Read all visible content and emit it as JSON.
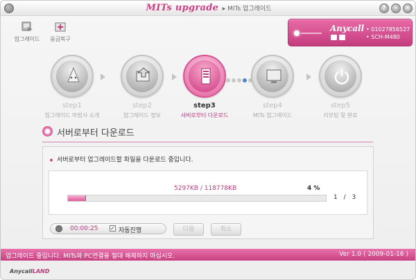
{
  "window": {
    "title_logo": "MITs upgrade",
    "title_sub": "▸ MITs 업그레이드",
    "help_label": "?",
    "minimize_label": "–",
    "close_label": "×"
  },
  "toolbar": {
    "items": [
      {
        "label": "업그레이드",
        "icon": "upgrade-icon"
      },
      {
        "label": "응급복구",
        "icon": "recovery-icon"
      }
    ]
  },
  "device": {
    "brand": "Anycall",
    "phone_number": "• 01027856527",
    "model": "• SCH-M480",
    "colors": {
      "panel": "#d94f90"
    }
  },
  "steps": [
    {
      "title": "step1",
      "desc": "업그레이드 마법사 소개",
      "icon": "wizard-icon",
      "active": false
    },
    {
      "title": "step2",
      "desc": "업그레이드 정보",
      "icon": "info-monitor-icon",
      "active": false
    },
    {
      "title": "step3",
      "desc": "서버로부터 다운로드",
      "icon": "server-icon",
      "active": true
    },
    {
      "title": "step4",
      "desc": "MITs 업그레이드",
      "icon": "upgrade-monitor-icon",
      "active": false
    },
    {
      "title": "step5",
      "desc": "리부팅 및 완료",
      "icon": "power-icon",
      "active": false
    }
  ],
  "section": {
    "title": "서버로부터 다운로드"
  },
  "download": {
    "message": "서버로부터 업그레이드할 파일을 다운로드 중입니다.",
    "progress_text": "5297KB / 118778KB",
    "percent_label": "4 %",
    "progress_fraction": 0.07,
    "file_count": "1 / 3",
    "elapsed": "00:00:25",
    "auto_label": "자동진행",
    "auto_checked": true
  },
  "buttons": {
    "next": "다음",
    "cancel": "취소"
  },
  "status": {
    "message": "업그레이드 중입니다. MITs와 PC연결을 절대 해제하지 마십시오.",
    "version": "Ver 1.0 ( 2009-01-16 )"
  },
  "footer": {
    "logo_main": "Anycall",
    "logo_accent": "LAND"
  },
  "colors": {
    "accent": "#d3488a",
    "status_bar": "#d64f91"
  }
}
